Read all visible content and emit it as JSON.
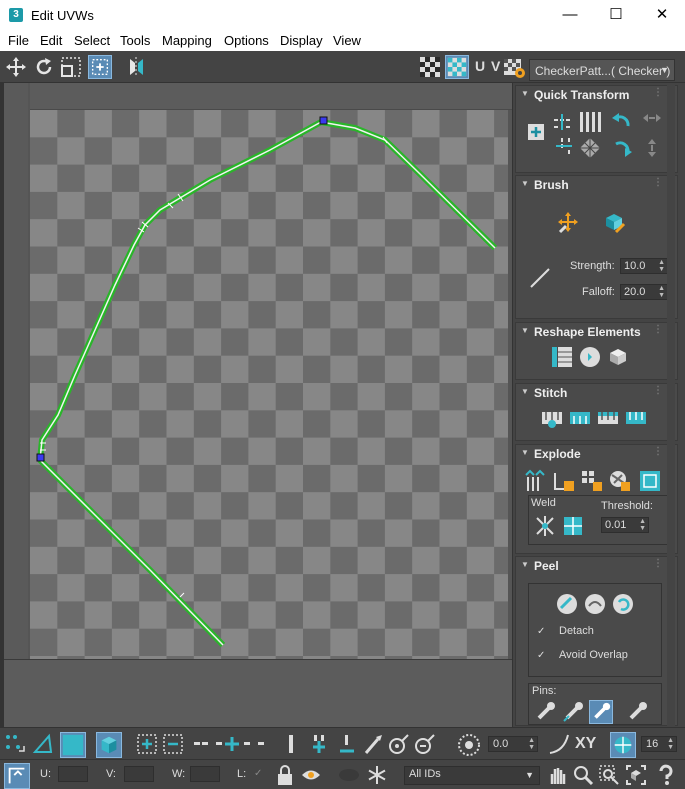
{
  "window": {
    "title": "Edit UVWs",
    "app_icon": "3"
  },
  "menu": [
    "File",
    "Edit",
    "Select",
    "Tools",
    "Mapping",
    "Options",
    "Display",
    "View"
  ],
  "toolbar": {
    "uv_label": "U V",
    "texture_dropdown": "CheckerPatt...( Checker )"
  },
  "panels": {
    "quick_transform": {
      "title": "Quick Transform"
    },
    "brush": {
      "title": "Brush",
      "strength_label": "Strength:",
      "strength_value": "10.0",
      "falloff_label": "Falloff:",
      "falloff_value": "20.0"
    },
    "reshape": {
      "title": "Reshape Elements"
    },
    "stitch": {
      "title": "Stitch"
    },
    "explode": {
      "title": "Explode",
      "weld_label": "Weld",
      "threshold_label": "Threshold:",
      "threshold_value": "0.01"
    },
    "peel": {
      "title": "Peel",
      "detach_label": "Detach",
      "avoid_overlap_label": "Avoid Overlap",
      "pins_label": "Pins:"
    }
  },
  "bottom": {
    "spinner_value": "0.0",
    "xy_label": "XY",
    "grid_value": "16",
    "u_label": "U:",
    "v_label": "V:",
    "w_label": "W:",
    "l_label": "L:",
    "ids_dropdown": "All IDs"
  }
}
